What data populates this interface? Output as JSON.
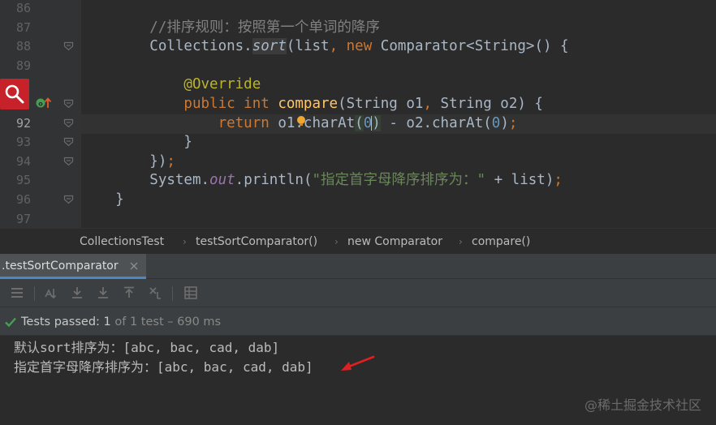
{
  "editor": {
    "line_numbers": [
      "86",
      "87",
      "88",
      "89",
      "",
      "",
      "92",
      "93",
      "94",
      "95",
      "96",
      "97"
    ],
    "current_line": "92",
    "lines": [
      {
        "tokens": []
      },
      {
        "tokens": [
          {
            "t": "        //排序规则：按照第一个单词的降序",
            "c": "tok-comment"
          }
        ]
      },
      {
        "tokens": [
          {
            "t": "        Collections.",
            "c": "tok-plain"
          },
          {
            "t": "sort",
            "c": "tok-static-italic tok-sort"
          },
          {
            "t": "(list",
            "c": "tok-plain"
          },
          {
            "t": ", ",
            "c": "tok-kw"
          },
          {
            "t": "new ",
            "c": "tok-kw"
          },
          {
            "t": "Comparator<String>() {",
            "c": "tok-plain"
          }
        ]
      },
      {
        "tokens": []
      },
      {
        "tokens": [
          {
            "t": "            @Override",
            "c": "tok-ann"
          }
        ]
      },
      {
        "tokens": [
          {
            "t": "            public int ",
            "c": "tok-kw"
          },
          {
            "t": "compare",
            "c": "tok-method"
          },
          {
            "t": "(String o1",
            "c": "tok-plain"
          },
          {
            "t": ", ",
            "c": "tok-kw"
          },
          {
            "t": "String o2) {",
            "c": "tok-plain"
          }
        ]
      },
      {
        "tokens": [
          {
            "t": "                return ",
            "c": "tok-kw"
          },
          {
            "t": "o1.charAt",
            "c": "tok-plain"
          },
          {
            "t": "(",
            "c": "tok-plain tok-hl"
          },
          {
            "t": "0",
            "c": "tok-num"
          },
          {
            "t": "CARET",
            "c": "caret"
          },
          {
            "t": ")",
            "c": "tok-plain tok-hl"
          },
          {
            "t": " - o2.charAt(",
            "c": "tok-plain"
          },
          {
            "t": "0",
            "c": "tok-num"
          },
          {
            "t": ")",
            "c": "tok-plain"
          },
          {
            "t": ";",
            "c": "tok-kw"
          }
        ]
      },
      {
        "tokens": [
          {
            "t": "            }",
            "c": "tok-plain"
          }
        ]
      },
      {
        "tokens": [
          {
            "t": "        })",
            "c": "tok-plain"
          },
          {
            "t": ";",
            "c": "tok-kw"
          }
        ]
      },
      {
        "tokens": [
          {
            "t": "        System.",
            "c": "tok-plain"
          },
          {
            "t": "out",
            "c": "tok-field-italic"
          },
          {
            "t": ".println(",
            "c": "tok-plain"
          },
          {
            "t": "\"指定首字母降序排序为：\"",
            "c": "tok-str"
          },
          {
            "t": " + list)",
            "c": "tok-plain"
          },
          {
            "t": ";",
            "c": "tok-kw"
          }
        ]
      },
      {
        "tokens": [
          {
            "t": "    }",
            "c": "tok-plain"
          }
        ]
      },
      {
        "tokens": []
      }
    ]
  },
  "breadcrumb": {
    "items": [
      "CollectionsTest",
      "testSortComparator()",
      "new Comparator",
      "compare()"
    ],
    "separator": "›"
  },
  "run_panel": {
    "tab_label": ".testSortComparator",
    "toolbar_icons": [
      "soft-wraps-icon",
      "sort-alpha-icon",
      "import-tests-icon",
      "export-tests-icon",
      "up-icon",
      "collapse-icon",
      "expand-icon",
      "grid-icon"
    ],
    "status": {
      "prefix": "Tests passed: ",
      "count": "1",
      "suffix": " of 1 test – 690 ms"
    },
    "console_lines": [
      "默认sort排序为：[abc, bac, cad, dab]",
      "指定首字母降序排序为：[abc, bac, cad, dab]"
    ]
  },
  "watermark": "@稀土掘金技术社区",
  "colors": {
    "accent": "#4a88c7",
    "pass": "#499c54",
    "search_overlay": "#c7222a",
    "arrow": "#e02020"
  }
}
